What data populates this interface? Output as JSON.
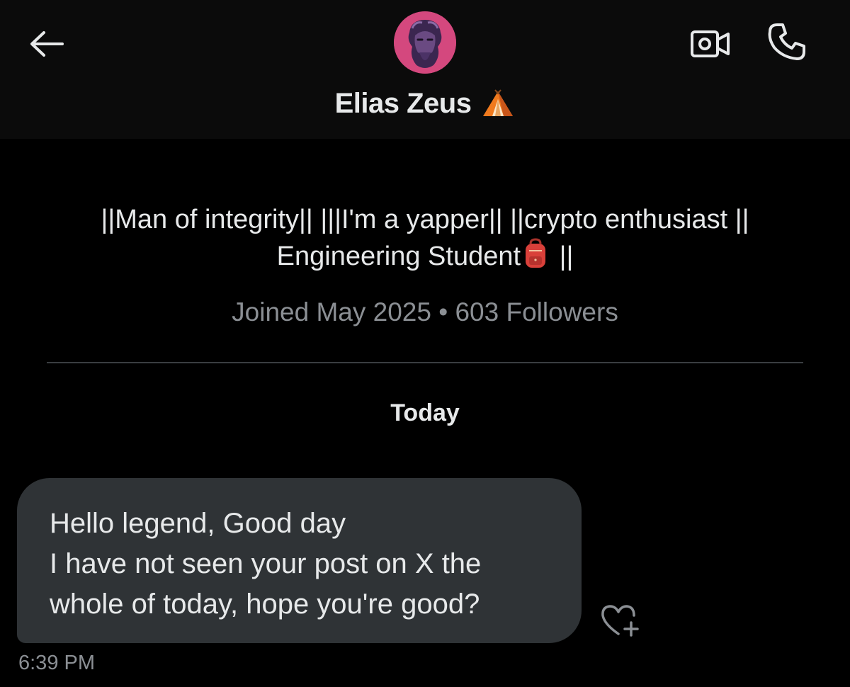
{
  "header": {
    "name": "Elias Zeus",
    "name_emoji_icon": "tent-emoji-icon",
    "back_icon": "back-arrow-icon",
    "video_icon": "video-camera-icon",
    "call_icon": "phone-icon",
    "avatar_icon": "avatar-bearded-statue"
  },
  "profile": {
    "bio_line1": "||Man of integrity|| |||I'm a yapper|| ||crypto enthusiast ||",
    "bio_line2_text": "Engineering Student",
    "bio_line2_emoji_icon": "backpack-emoji-icon",
    "bio_line2_tail": " ||",
    "joined": "Joined May 2025",
    "separator": " • ",
    "followers": "603 Followers"
  },
  "conversation": {
    "date_label": "Today",
    "messages": [
      {
        "lines": [
          "Hello legend, Good day",
          "I have not seen your post on X the",
          "whole of today, hope you're good?"
        ],
        "time": "6:39 PM",
        "react_icon": "add-reaction-heart-icon"
      }
    ]
  },
  "colors": {
    "background": "#000000",
    "header_background": "#0b0b0b",
    "text_primary": "#e7e9ea",
    "text_secondary": "#8b8f94",
    "bubble_background": "#2f3336",
    "divider": "#3a3d41",
    "avatar_accent": "#d4487e"
  }
}
